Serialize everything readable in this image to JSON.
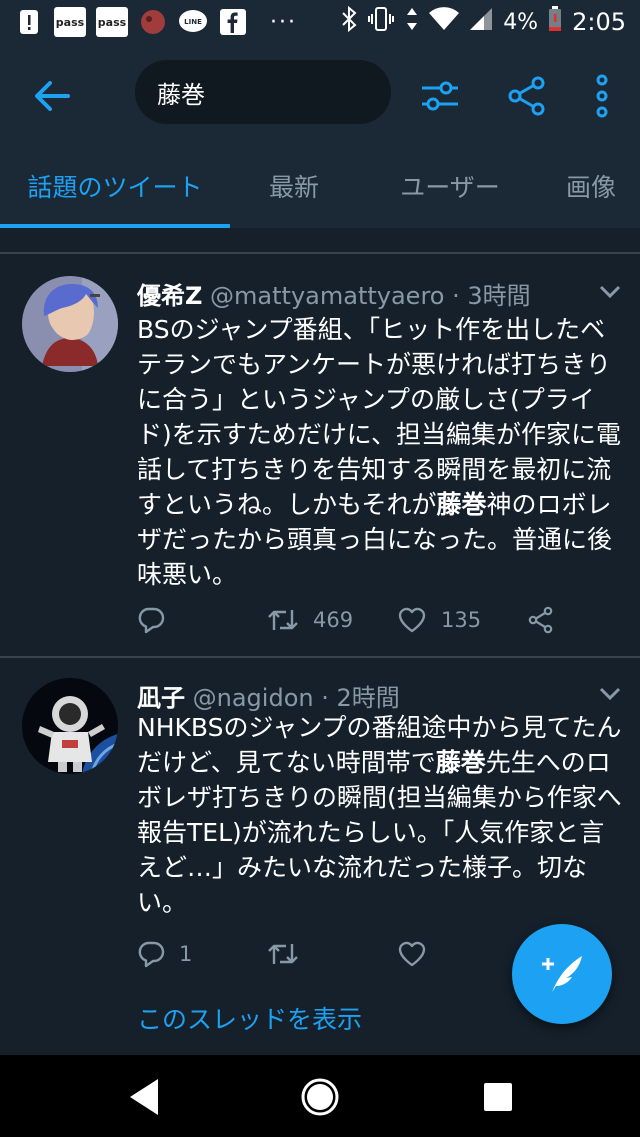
{
  "status_bar": {
    "pass1": "pass",
    "pass2": "pass",
    "dots": "···",
    "battery": "4%",
    "time": "2:05",
    "icons": [
      "alert-icon",
      "pass-icon",
      "pass-icon",
      "app-icon",
      "line-icon",
      "facebook-icon",
      "bluetooth-icon",
      "vibrate-icon",
      "data-icon",
      "wifi-icon",
      "signal-icon",
      "battery-icon"
    ]
  },
  "search": {
    "query": "藤巻"
  },
  "tabs": [
    {
      "label": "話題のツイート",
      "active": true
    },
    {
      "label": "最新",
      "active": false
    },
    {
      "label": "ユーザー",
      "active": false
    },
    {
      "label": "画像",
      "active": false
    }
  ],
  "tweets": [
    {
      "name": "優希Z",
      "handle": "@mattyamattyaero",
      "time": "· 3時間",
      "text_before": "BSのジャンプ番組、「ヒット作を出したベテランでもアンケートが悪ければ打ちきりに合う」というジャンプの厳しさ(プライド)を示すためだけに、担当編集が作家に電話して打ちきりを告知する瞬間を最初に流すというね。しかもそれが",
      "highlight": "藤巻",
      "text_after": "神のロボレザだったから頭真っ白になった。普通に後味悪い。",
      "retweets": "469",
      "likes": "135"
    },
    {
      "name": "凪子",
      "handle": "@nagidon",
      "time": "· 2時間",
      "text_before": "NHKBSのジャンプの番組途中から見てたんだけど、見てない時間帯で",
      "highlight": "藤巻",
      "text_after": "先生へのロボレザ打ちきりの瞬間(担当編集から作家へ報告TEL)が流れたらしい。「人気作家と言えど…」みたいな流れだった様子。切ない。",
      "replies": "1"
    }
  ],
  "thread_link": "このスレッドを表示",
  "colors": {
    "background": "#15202b",
    "header": "#1b2836",
    "accent": "#1da1f2",
    "muted": "#8899a6"
  }
}
